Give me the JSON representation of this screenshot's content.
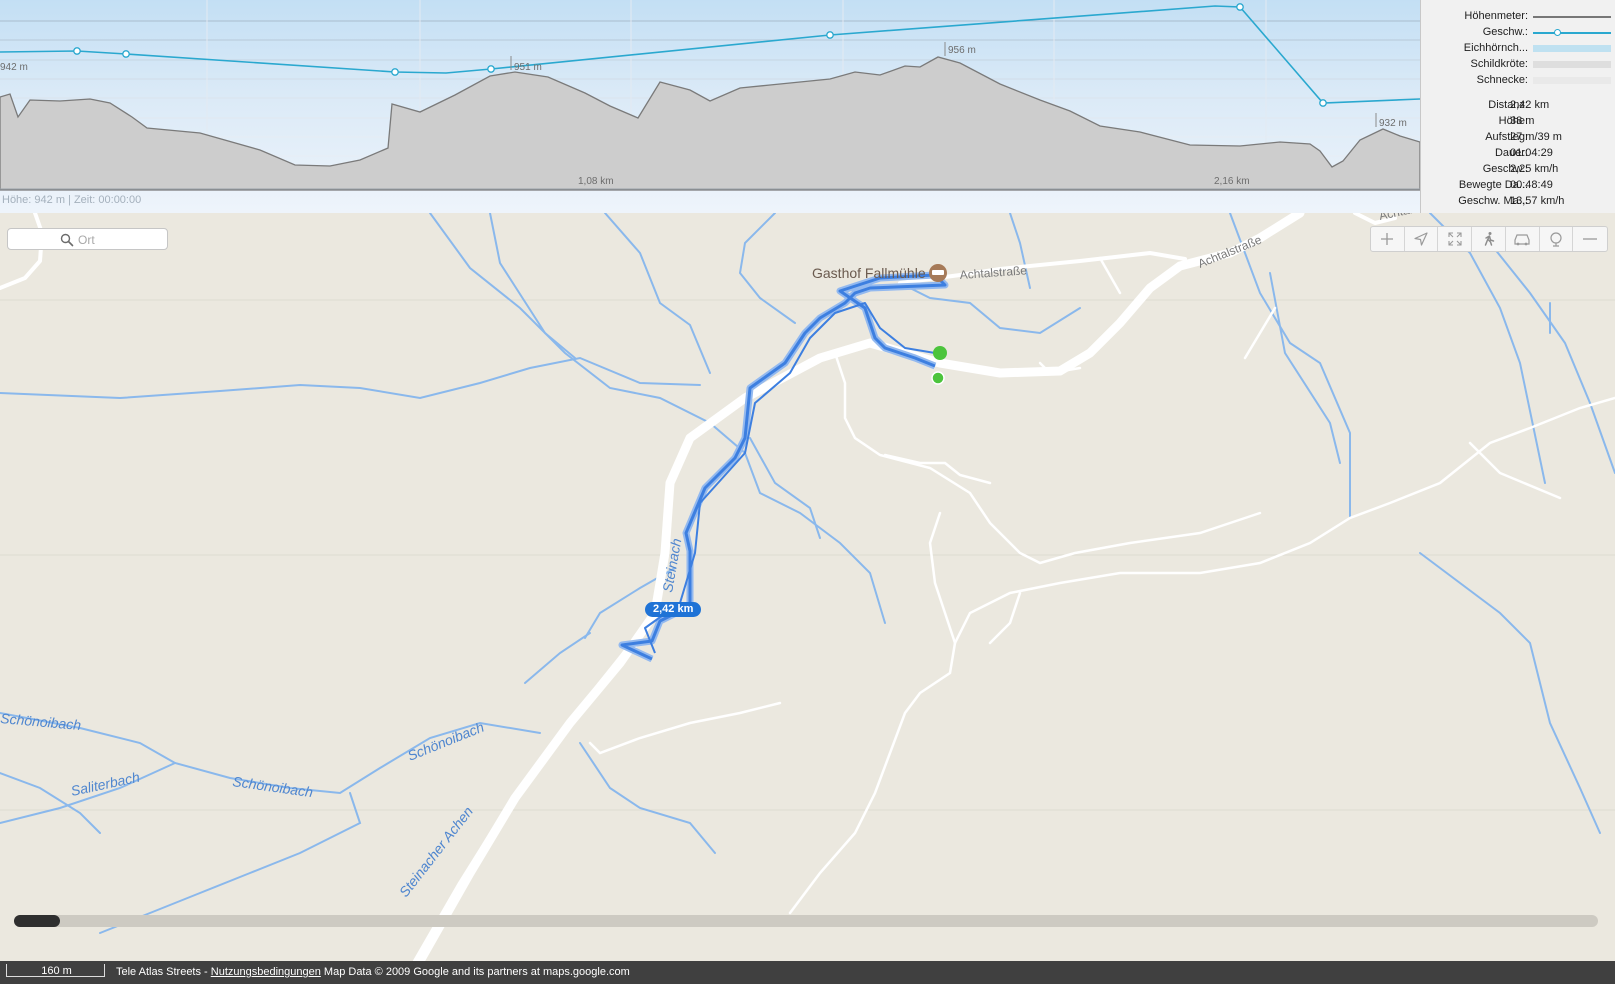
{
  "chart": {
    "status_text": "Höhe: 942 m | Zeit: 00:00:00",
    "labels": {
      "alt_left": "942 m",
      "alt_mid": "951 m",
      "alt_top": "956 m",
      "alt_right": "932 m",
      "dist_1": "1,08 km",
      "dist_2": "2,16 km"
    },
    "colors": {
      "elevation_fill": "#cdcdcd",
      "elevation_line": "#7a7a7a",
      "speed_line": "#2aa8cf"
    }
  },
  "legend": [
    {
      "label": "Höhenmeter:",
      "color": "#777777"
    },
    {
      "label": "Geschw.:",
      "color": "#2aa8cf"
    },
    {
      "label": "Eichhörnch...",
      "color": "#bfe1f1"
    },
    {
      "label": "Schildkröte:",
      "color": "#dedede"
    },
    {
      "label": "Schnecke:",
      "color": "#e9e9e9"
    }
  ],
  "stats": [
    {
      "label": "Distanz:",
      "value": "2,42 km"
    },
    {
      "label": "Höhe:",
      "value": "38 m"
    },
    {
      "label": "Aufstieg:",
      "value": "27 m/39 m"
    },
    {
      "label": "Dauer:",
      "value": "01:04:29"
    },
    {
      "label": "Geschw.:",
      "value": "2,25 km/h"
    },
    {
      "label": "Bewegte Da...",
      "value": "00:48:49"
    },
    {
      "label": "Geschw. Ma...",
      "value": "13,57 km/h"
    }
  ],
  "search": {
    "placeholder": "Ort"
  },
  "map": {
    "poi": "Gasthof Fallmühle",
    "streets": {
      "achtal_1": "Achtalstraße",
      "achtal_2": "Achtalstraße",
      "achtal_3": "Achtal"
    },
    "streams": {
      "schoenoibach_1": "Schönoibach",
      "schoenoibach_2": "Schönoibach",
      "schoenoibach_3": "Schönoibach",
      "saliterbach": "Saliterbach",
      "steinacher_1": "Steinacher Achen",
      "steinacher_2": "Steinach"
    },
    "route_label": "2,42 km",
    "colors": {
      "route": "#3d7fe0",
      "water": "#8ab8ec",
      "road": "#ffffff",
      "start_marker": "#4cc43c"
    }
  },
  "toolbar": {
    "buttons": [
      {
        "name": "zoom-in-button",
        "icon": "plus-icon"
      },
      {
        "name": "locate-button",
        "icon": "location-arrow-icon"
      },
      {
        "name": "fullscreen-button",
        "icon": "expand-icon"
      },
      {
        "name": "walking-mode-button",
        "icon": "walking-icon"
      },
      {
        "name": "driving-mode-button",
        "icon": "car-icon"
      },
      {
        "name": "satellite-button",
        "icon": "globe-icon"
      },
      {
        "name": "zoom-out-button",
        "icon": "minus-icon"
      }
    ]
  },
  "footer": {
    "scale": "160 m",
    "attribution_prefix": "Tele Atlas Streets - ",
    "terms_link": "Nutzungsbedingungen",
    "attribution_suffix": " Map Data © 2009 Google and its partners at maps.google.com"
  }
}
